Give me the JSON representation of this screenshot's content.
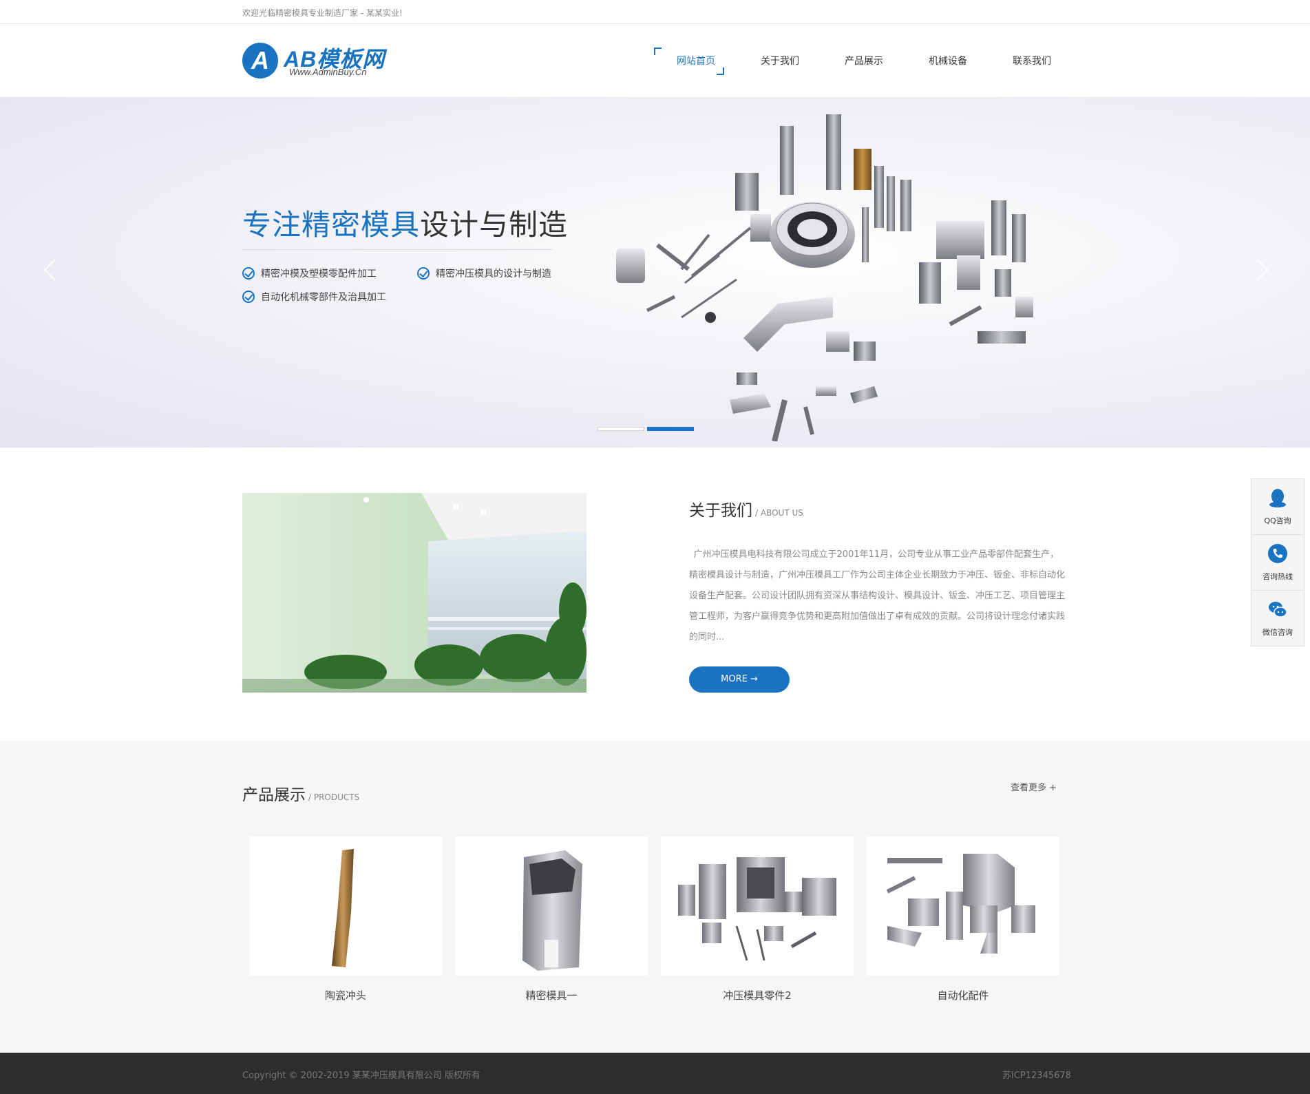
{
  "topbar": {
    "welcome": "欢迎光临精密模具专业制造厂家 - 某某实业!"
  },
  "logo": {
    "mark": "A",
    "name": "AB模板网",
    "sub": "Www.AdminBuy.Cn"
  },
  "nav": [
    {
      "label": "网站首页",
      "active": true
    },
    {
      "label": "关于我们",
      "active": false
    },
    {
      "label": "产品展示",
      "active": false
    },
    {
      "label": "机械设备",
      "active": false
    },
    {
      "label": "联系我们",
      "active": false
    }
  ],
  "banner": {
    "title_highlight": "专注精密模具",
    "title_rest": "设计与制造",
    "features": [
      "精密冲模及塑模零配件加工",
      "精密冲压模具的设计与制造",
      "自动化机械零部件及治具加工"
    ],
    "active_slide": 2,
    "slide_count": 2
  },
  "about": {
    "title": "关于我们",
    "title_en": "/ ABOUT US",
    "text": "广州冲压模具电科技有限公司成立于2001年11月，公司专业从事工业产品零部件配套生产，精密模具设计与制造，广州冲压模具工厂作为公司主体企业长期致力于冲压、钣金、非标自动化设备生产配套。公司设计团队拥有资深从事结构设计、模具设计、钣金、冲压工艺、项目管理主管工程师，为客户赢得竞争优势和更高附加值做出了卓有成效的贡献。公司将设计理念付诸实践的同时...",
    "more": "MORE →"
  },
  "products": {
    "title": "产品展示",
    "title_en": "/ PRODUCTS",
    "more": "查看更多 +",
    "items": [
      {
        "name": "陶瓷冲头"
      },
      {
        "name": "精密模具一"
      },
      {
        "name": "冲压模具零件2"
      },
      {
        "name": "自动化配件"
      }
    ]
  },
  "footer": {
    "copyright": "Copyright © 2002-2019 某某冲压模具有限公司 版权所有",
    "icp": "苏ICP12345678"
  },
  "side": [
    {
      "label": "QQ咨询",
      "icon": "qq-icon"
    },
    {
      "label": "咨询热线",
      "icon": "phone-icon"
    },
    {
      "label": "微信咨询",
      "icon": "wechat-icon"
    }
  ],
  "colors": {
    "accent": "#1a73c0",
    "footer": "#2d2d2d",
    "products_bg": "#f6f6f6"
  }
}
